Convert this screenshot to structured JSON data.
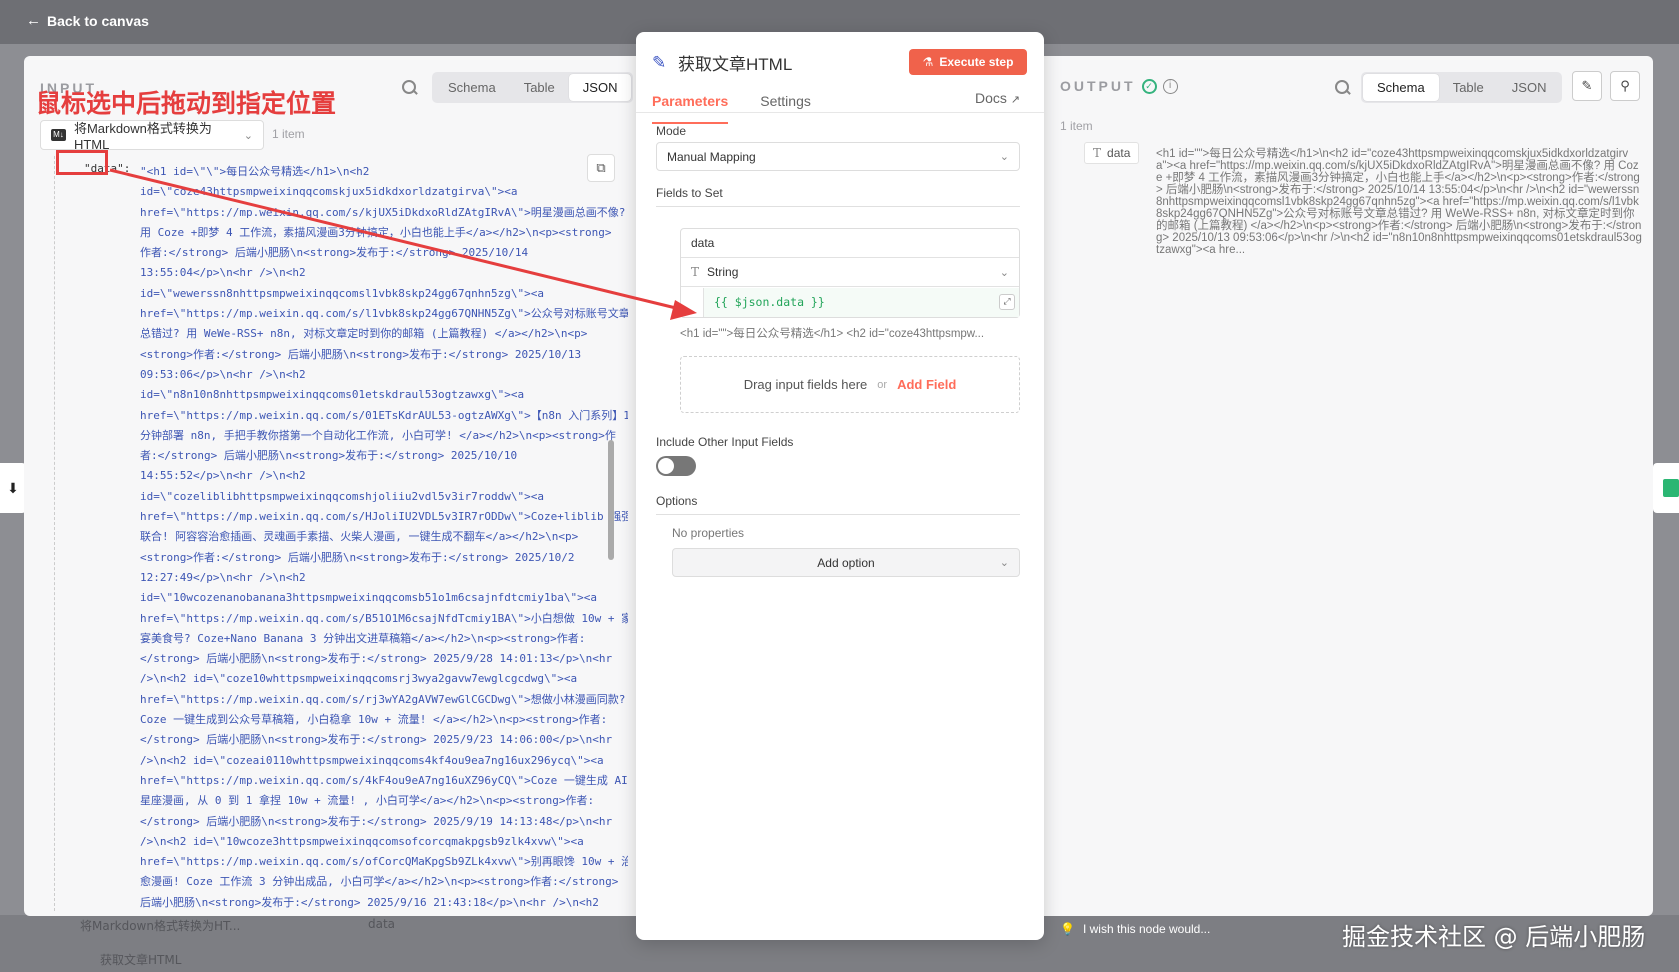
{
  "topbar": {
    "back_label": "Back to canvas"
  },
  "input": {
    "title": "INPUT",
    "annotation": "鼠标选中后拖动到指定位置",
    "view_tabs": [
      "Schema",
      "Table",
      "JSON"
    ],
    "active_tab": "JSON",
    "node_select": "将Markdown格式转换为HTML",
    "item_count": "1 item",
    "json_key": "\"data\":",
    "json_lines": [
      "\"<h1 id=\\\"\\\">每日公众号精选</h1>\\n<h2",
      "id=\\\"coze43httpsmpweixinqqcomskjux5idkdxorldzatgirva\\\"><a",
      "href=\\\"https://mp.weixin.qq.com/s/kjUX5iDkdxoRldZAtgIRvA\\\">明星漫画总画不像?",
      "用 Coze +即梦 4 工作流，素描风漫画3分钟搞定，小白也能上手</a></h2>\\n<p><strong>",
      "作者:</strong> 后端小肥肠\\n<strong>发布于:</strong> 2025/10/14",
      "13:55:04</p>\\n<hr />\\n<h2",
      "id=\\\"wewerssn8nhttpsmpweixinqqcomsl1vbk8skp24gg67qnhn5zg\\\"><a",
      "href=\\\"https://mp.weixin.qq.com/s/l1vbk8skp24gg67QNHN5Zg\\\">公众号对标账号文章",
      "总错过? 用 WeWe-RSS+ n8n, 对标文章定时到你的邮箱 (上篇教程) </a></h2>\\n<p>",
      "<strong>作者:</strong> 后端小肥肠\\n<strong>发布于:</strong> 2025/10/13",
      "09:53:06</p>\\n<hr />\\n<h2",
      "id=\\\"n8n10n8nhttpsmpweixinqqcoms01etskdraul53ogtzawxg\\\"><a",
      "href=\\\"https://mp.weixin.qq.com/s/01ETsKdrAUL53-ogtzAWXg\\\">【n8n 入门系列】10",
      "分钟部署 n8n, 手把手教你搭第一个自动化工作流, 小白可学! </a></h2>\\n<p><strong>作",
      "者:</strong> 后端小肥肠\\n<strong>发布于:</strong> 2025/10/10",
      "14:55:52</p>\\n<hr />\\n<h2",
      "id=\\\"cozeliblibhttpsmpweixinqqcomshjoliiu2vdl5v3ir7roddw\\\"><a",
      "href=\\\"https://mp.weixin.qq.com/s/HJoliIU2VDL5v3IR7rODDw\\\">Coze+liblib 强强",
      "联合! 阿容容治愈插画、灵魂画手素描、火柴人漫画, 一键生成不翻车</a></h2>\\n<p>",
      "<strong>作者:</strong> 后端小肥肠\\n<strong>发布于:</strong> 2025/10/2",
      "12:27:49</p>\\n<hr />\\n<h2",
      "id=\\\"10wcozenanobanana3httpsmpweixinqqcomsb51o1m6csajnfdtcmiy1ba\\\"><a",
      "href=\\\"https://mp.weixin.qq.com/s/B51O1M6csajNfdTcmiy1BA\\\">小白想做 10w + 家",
      "宴美食号? Coze+Nano Banana 3 分钟出文进草稿箱</a></h2>\\n<p><strong>作者:",
      "</strong> 后端小肥肠\\n<strong>发布于:</strong> 2025/9/28 14:01:13</p>\\n<hr",
      "/>\\n<h2 id=\\\"coze10whttpsmpweixinqqcomsrj3wya2gavw7ewglcgcdwg\\\"><a",
      "href=\\\"https://mp.weixin.qq.com/s/rj3wYA2gAVW7ewGlCGCDwg\\\">想做小林漫画同款?",
      "Coze 一键生成到公众号草稿箱, 小白稳拿 10w + 流量! </a></h2>\\n<p><strong>作者:",
      "</strong> 后端小肥肠\\n<strong>发布于:</strong> 2025/9/23 14:06:00</p>\\n<hr",
      "/>\\n<h2 id=\\\"cozeai0110whttpsmpweixinqqcoms4kf4ou9ea7ng16ux296ycq\\\"><a",
      "href=\\\"https://mp.weixin.qq.com/s/4kF4ou9eA7ng16uXZ96yCQ\\\">Coze 一键生成 AI",
      "星座漫画, 从 0 到 1 拿捏 10w + 流量! , 小白可学</a></h2>\\n<p><strong>作者:",
      "</strong> 后端小肥肠\\n<strong>发布于:</strong> 2025/9/19 14:13:48</p>\\n<hr",
      "/>\\n<h2 id=\\\"10wcoze3httpsmpweixinqqcomsofcorcqmakpgsb9zlk4xvw\\\"><a",
      "href=\\\"https://mp.weixin.qq.com/s/ofCorcQMaKpgSb9ZLk4xvw\\\">别再眼馋 10w + 治",
      "愈漫画! Coze 工作流 3 分钟出成品, 小白可学</a></h2>\\n<p><strong>作者:</strong>",
      "后端小肥肠\\n<strong>发布于:</strong> 2025/9/16 21:43:18</p>\\n<hr />\\n<h2"
    ]
  },
  "node": {
    "title": "获取文章HTML",
    "execute_label": "Execute step",
    "tabs": [
      "Parameters",
      "Settings"
    ],
    "active_tab": "Parameters",
    "docs_label": "Docs",
    "mode_label": "Mode",
    "mode_value": "Manual Mapping",
    "fields_label": "Fields to Set",
    "field_name": "data",
    "field_type": "String",
    "field_value": "{{ $json.data }}",
    "field_preview": "<h1 id=\"\">每日公众号精选</h1> <h2 id=\"coze43httpsmpw...",
    "drop_text": "Drag input fields here",
    "drop_or": "or",
    "add_field_label": "Add Field",
    "include_label": "Include Other Input Fields",
    "include_enabled": false,
    "options_label": "Options",
    "no_props": "No properties",
    "add_option_label": "Add option"
  },
  "output": {
    "title": "OUTPUT",
    "item_count": "1 item",
    "view_tabs": [
      "Schema",
      "Table",
      "JSON"
    ],
    "active_tab": "Schema",
    "field_name": "data",
    "field_value": "<h1 id=\"\">每日公众号精选</h1>\\n<h2 id=\"coze43httpsmpweixinqqcomskjux5idkdxorldzatgirva\"><a href=\"https://mp.weixin.qq.com/s/kjUX5iDkdxoRldZAtgIRvA\">明星漫画总画不像? 用 Coze +即梦 4 工作流，素描风漫画3分钟搞定，小白也能上手</a></h2>\\n<p><strong>作者:</strong> 后端小肥肠\\n<strong>发布于:</strong> 2025/10/14 13:55:04</p>\\n<hr />\\n<h2 id=\"wewerssn8nhttpsmpweixinqqcomsl1vbk8skp24gg67qnhn5zg\"><a href=\"https://mp.weixin.qq.com/s/l1vbk8skp24gg67QNHN5Zg\">公众号对标账号文章总错过? 用 WeWe-RSS+ n8n, 对标文章定时到你的邮箱 (上篇教程) </a></h2>\\n<p><strong>作者:</strong> 后端小肥肠\\n<strong>发布于:</strong> 2025/10/13 09:53:06</p>\\n<hr />\\n<h2 id=\"n8n10n8nhttpsmpweixinqqcoms01etskdraul53ogtzawxg\"><a hre...",
    "feedback": "I wish this node would..."
  },
  "canvas_bg": {
    "node_label": "将Markdown格式转换为HT...",
    "node_label_2": "获取文章HTML",
    "data_label": "data"
  },
  "watermark": "掘金技术社区 @ 后端小肥肠",
  "colors": {
    "accent": "#ff6d5a",
    "execute": "#f0624b",
    "annotation": "#e53e3e",
    "json_text": "#3d56b4",
    "success": "#35b37e"
  }
}
